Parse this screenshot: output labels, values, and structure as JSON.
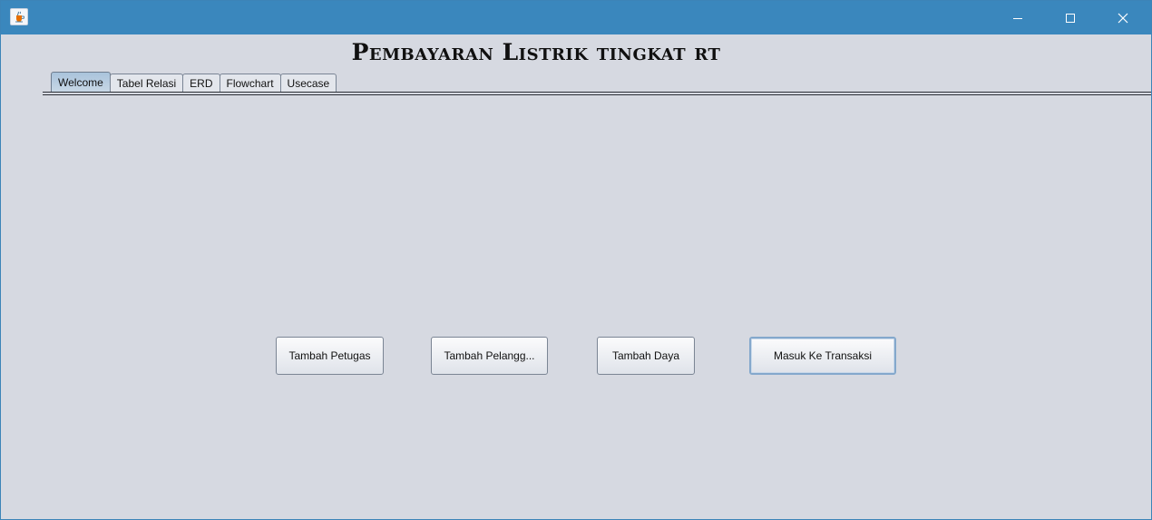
{
  "window": {
    "title": "",
    "controls": {
      "minimize": "minimize",
      "maximize": "maximize",
      "close": "close"
    }
  },
  "header": {
    "title": "Pembayaran Listrik tingkat rt"
  },
  "tabs": [
    {
      "label": "Welcome",
      "selected": true
    },
    {
      "label": "Tabel Relasi",
      "selected": false
    },
    {
      "label": "ERD",
      "selected": false
    },
    {
      "label": "Flowchart",
      "selected": false
    },
    {
      "label": "Usecase",
      "selected": false
    }
  ],
  "buttons": {
    "tambah_petugas": "Tambah Petugas",
    "tambah_pelanggan": "Tambah Pelangg...",
    "tambah_daya": "Tambah Daya",
    "masuk_transaksi": "Masuk Ke Transaksi"
  },
  "colors": {
    "titlebar": "#3a87bd",
    "background": "#d6d9e1",
    "focus_border": "#84a8cc"
  },
  "icons": {
    "app": "java-coffee-cup-icon"
  }
}
